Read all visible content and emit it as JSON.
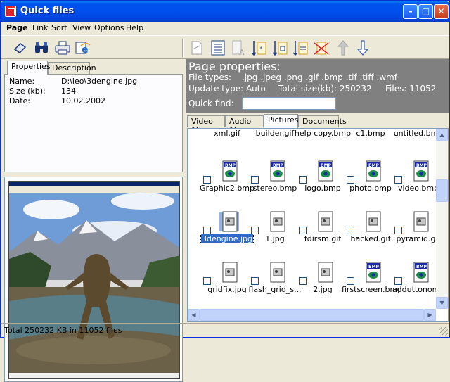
{
  "window": {
    "title": "Quick files",
    "min": "–",
    "max": "□",
    "close": "✕"
  },
  "menu": [
    "Page",
    "Link",
    "Sort",
    "View",
    "Options",
    "Help"
  ],
  "toolbar_left": [
    "eraser-icon",
    "binoculars-icon",
    "printer-icon",
    "browser-icon"
  ],
  "toolbar_right": [
    "document-icon",
    "list-icon",
    "sort-name-icon",
    "sort-ext-icon",
    "sort-size-icon",
    "sort-date-icon",
    "clear-sort-icon",
    "up-arrow-icon",
    "down-arrow-icon"
  ],
  "left_tabs": [
    "Properties",
    "Description"
  ],
  "properties": {
    "name_label": "Name:",
    "name_value": "D:\\leo\\3dengine.jpg",
    "size_label": "Size (kb):",
    "size_value": "134",
    "date_label": "Date:",
    "date_value": "10.02.2002"
  },
  "page_props": {
    "title": "Page properties:",
    "file_types_label": "File types:",
    "file_types_value": ".jpg .jpeg .png .gif .bmp .tif .tiff .wmf",
    "update_type": "Update type: Auto",
    "total_size": "Total size(kb):  250232",
    "files": "Files:  11052",
    "quick_find_label": "Quick find:",
    "quick_find_value": ""
  },
  "right_tabs": [
    "Video files",
    "Audio files",
    "Pictures",
    "Documents"
  ],
  "files_row0": [
    "xml.gif",
    "builder.gif",
    "help copy.bmp",
    "c1.bmp",
    "untitled.bmp"
  ],
  "files_row1": [
    "Graphic2.bmp",
    "stereo.bmp",
    "logo.bmp",
    "photo.bmp",
    "video.bmp"
  ],
  "files_row2": [
    "3dengine.jpg",
    "1.jpg",
    "fdirsm.gif",
    "hacked.gif",
    "pyramid.gif"
  ],
  "files_row3": [
    "gridfix.jpg",
    "flash_grid_s...",
    "2.jpg",
    "firstscreen.bmp",
    "adduttonon..."
  ],
  "bmp_badge": "BMP",
  "status": "Total 250232 KB in 11052 files",
  "colors": {
    "title_bar": "#0050ee",
    "header_bg": "#808080",
    "selection": "#316ac5"
  }
}
